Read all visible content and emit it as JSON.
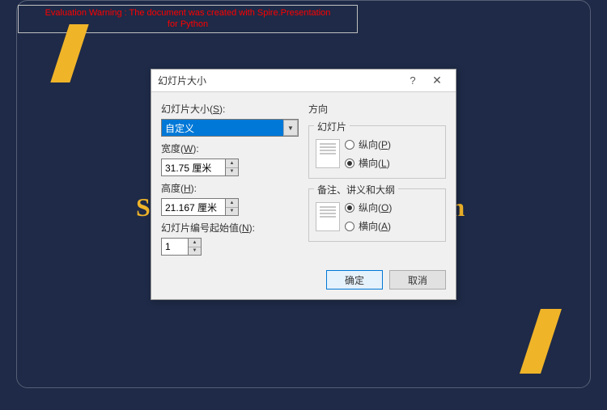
{
  "warning": {
    "line1": "Evaluation Warning : The document was created with Spire.Presentation",
    "line2": "for Python"
  },
  "background_title": "Spire.Presentation for Python",
  "dialog": {
    "title": "幻灯片大小",
    "help_symbol": "?",
    "close_symbol": "✕",
    "size_label_prefix": "幻灯片大小(",
    "size_label_key": "S",
    "size_label_suffix": "):",
    "size_value": "自定义",
    "width_label_prefix": "宽度(",
    "width_label_key": "W",
    "width_label_suffix": "):",
    "width_value": "31.75 厘米",
    "height_label_prefix": "高度(",
    "height_label_key": "H",
    "height_label_suffix": "):",
    "height_value": "21.167 厘米",
    "start_label_prefix": "幻灯片编号起始值(",
    "start_label_key": "N",
    "start_label_suffix": "):",
    "start_value": "1",
    "orientation_label": "方向",
    "group_slides": "幻灯片",
    "group_notes": "备注、讲义和大纲",
    "portrait_prefix": "纵向(",
    "portrait_key_slides": "P",
    "portrait_key_notes": "O",
    "portrait_suffix": ")",
    "landscape_prefix": "横向(",
    "landscape_key_slides": "L",
    "landscape_key_notes": "A",
    "landscape_suffix": ")",
    "slides_orientation": "landscape",
    "notes_orientation": "portrait",
    "ok": "确定",
    "cancel": "取消"
  }
}
